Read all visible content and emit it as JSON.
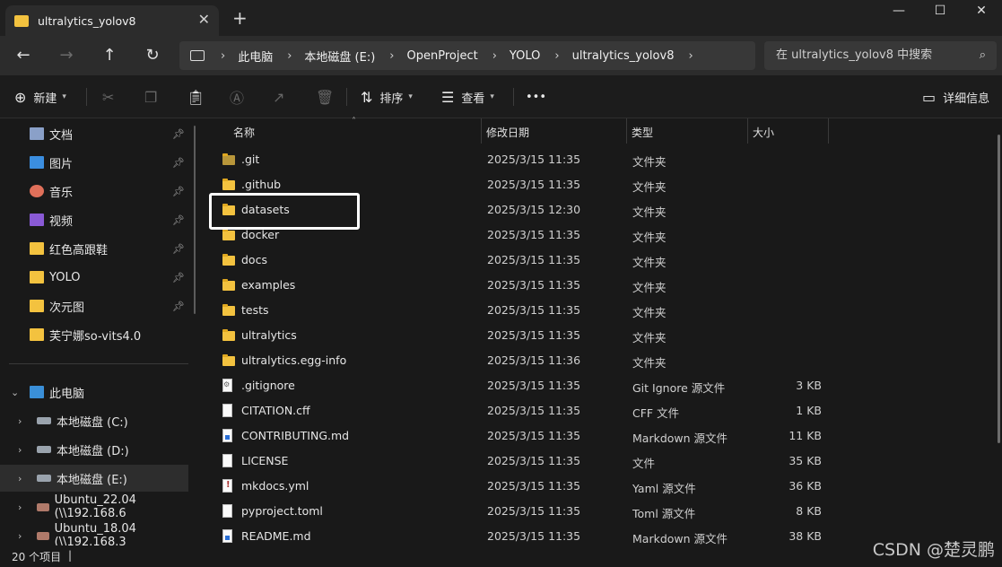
{
  "window": {
    "tab_title": "ultralytics_yolov8",
    "tab_close": "✕",
    "new_tab": "+",
    "minimize": "—",
    "maximize": "☐",
    "close": "✕"
  },
  "nav": {
    "back": "←",
    "forward": "→",
    "up": "↑",
    "refresh": "↻",
    "breadcrumbs": [
      "此电脑",
      "本地磁盘 (E:)",
      "OpenProject",
      "YOLO",
      "ultralytics_yolov8"
    ],
    "search_placeholder": "在 ultralytics_yolov8 中搜索"
  },
  "toolbar": {
    "new_label": "新建",
    "sort_label": "排序",
    "view_label": "查看",
    "more": "•••",
    "details_label": "详细信息"
  },
  "sidebar": {
    "quick": [
      {
        "label": "文档",
        "icon": "documents-icon"
      },
      {
        "label": "图片",
        "icon": "pictures-icon"
      },
      {
        "label": "音乐",
        "icon": "music-icon"
      },
      {
        "label": "视频",
        "icon": "videos-icon"
      },
      {
        "label": "红色高跟鞋",
        "icon": "folder-icon"
      },
      {
        "label": "YOLO",
        "icon": "folder-icon"
      },
      {
        "label": "次元图",
        "icon": "folder-icon"
      },
      {
        "label": "芙宁娜so-vits4.0",
        "icon": "folder-icon"
      }
    ],
    "this_pc": "此电脑",
    "drives": [
      {
        "label": "本地磁盘 (C:)"
      },
      {
        "label": "本地磁盘 (D:)"
      },
      {
        "label": "本地磁盘 (E:)",
        "selected": true
      },
      {
        "label": "Ubuntu_22.04 (\\\\192.168.6"
      },
      {
        "label": "Ubuntu_18.04 (\\\\192.168.3"
      }
    ]
  },
  "columns": {
    "name": "名称",
    "modified": "修改日期",
    "type": "类型",
    "size": "大小"
  },
  "files": [
    {
      "name": ".git",
      "date": "2025/3/15 11:35",
      "type": "文件夹",
      "size": "",
      "icon": "folder-dark"
    },
    {
      "name": ".github",
      "date": "2025/3/15 11:35",
      "type": "文件夹",
      "size": "",
      "icon": "folder"
    },
    {
      "name": "datasets",
      "date": "2025/3/15 12:30",
      "type": "文件夹",
      "size": "",
      "icon": "folder"
    },
    {
      "name": "docker",
      "date": "2025/3/15 11:35",
      "type": "文件夹",
      "size": "",
      "icon": "folder"
    },
    {
      "name": "docs",
      "date": "2025/3/15 11:35",
      "type": "文件夹",
      "size": "",
      "icon": "folder"
    },
    {
      "name": "examples",
      "date": "2025/3/15 11:35",
      "type": "文件夹",
      "size": "",
      "icon": "folder"
    },
    {
      "name": "tests",
      "date": "2025/3/15 11:35",
      "type": "文件夹",
      "size": "",
      "icon": "folder"
    },
    {
      "name": "ultralytics",
      "date": "2025/3/15 11:35",
      "type": "文件夹",
      "size": "",
      "icon": "folder"
    },
    {
      "name": "ultralytics.egg-info",
      "date": "2025/3/15 11:36",
      "type": "文件夹",
      "size": "",
      "icon": "folder"
    },
    {
      "name": ".gitignore",
      "date": "2025/3/15 11:35",
      "type": "Git Ignore 源文件",
      "size": "3 KB",
      "icon": "doc-gear"
    },
    {
      "name": "CITATION.cff",
      "date": "2025/3/15 11:35",
      "type": "CFF 文件",
      "size": "1 KB",
      "icon": "doc"
    },
    {
      "name": "CONTRIBUTING.md",
      "date": "2025/3/15 11:35",
      "type": "Markdown 源文件",
      "size": "11 KB",
      "icon": "doc-blue"
    },
    {
      "name": "LICENSE",
      "date": "2025/3/15 11:35",
      "type": "文件",
      "size": "35 KB",
      "icon": "doc"
    },
    {
      "name": "mkdocs.yml",
      "date": "2025/3/15 11:35",
      "type": "Yaml 源文件",
      "size": "36 KB",
      "icon": "doc-yaml"
    },
    {
      "name": "pyproject.toml",
      "date": "2025/3/15 11:35",
      "type": "Toml 源文件",
      "size": "8 KB",
      "icon": "doc"
    },
    {
      "name": "README.md",
      "date": "2025/3/15 11:35",
      "type": "Markdown 源文件",
      "size": "38 KB",
      "icon": "doc-blue"
    }
  ],
  "status": {
    "item_count": "20 个项目",
    "cursor": "|"
  },
  "watermark": "CSDN @楚灵鹏"
}
